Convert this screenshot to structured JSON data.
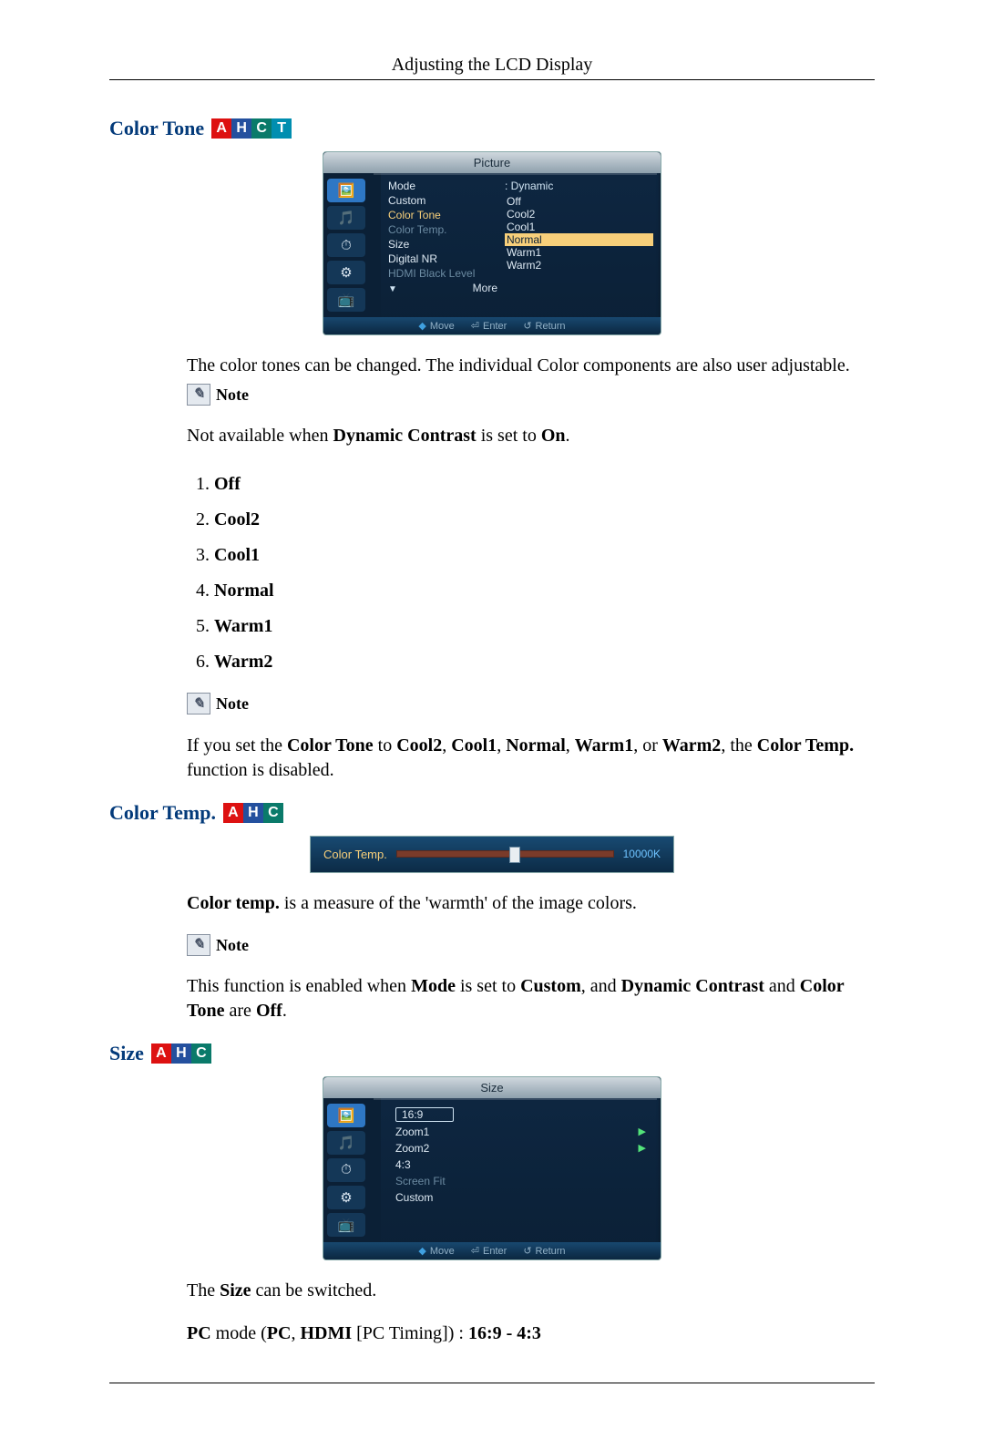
{
  "header": "Adjusting the LCD Display",
  "sections": {
    "colorTone": {
      "title": "Color Tone",
      "badges": [
        "A",
        "H",
        "C",
        "T"
      ],
      "osd": {
        "title": "Picture",
        "rows": [
          {
            "label": "Mode",
            "value": ": Dynamic"
          },
          {
            "label": "Custom",
            "value": ""
          },
          {
            "label": "Color Tone",
            "value": ": ",
            "sel": true
          },
          {
            "label": "Color Temp.",
            "value": ": ",
            "dim": true
          },
          {
            "label": "Size",
            "value": ": "
          },
          {
            "label": "Digital NR",
            "value": ": "
          },
          {
            "label": "HDMI Black Level",
            "value": ": ",
            "dim": true
          },
          {
            "label": "More",
            "value": "",
            "arrow": true
          }
        ],
        "options": [
          {
            "label": "Off"
          },
          {
            "label": "Cool2"
          },
          {
            "label": "Cool1"
          },
          {
            "label": "Normal",
            "hl": true
          },
          {
            "label": "Warm1"
          },
          {
            "label": "Warm2"
          }
        ],
        "footer": {
          "move": "Move",
          "enter": "Enter",
          "return": "Return"
        }
      },
      "desc": "The color tones can be changed. The individual Color components are also user adjustable.",
      "noteLabel": "Note",
      "noteText_parts": [
        "Not available when ",
        "Dynamic Contrast",
        " is set to ",
        "On",
        "."
      ],
      "list": [
        "Off",
        "Cool2",
        "Cool1",
        "Normal",
        "Warm1",
        "Warm2"
      ],
      "noteLabel2": "Note",
      "note2_parts": [
        "If you set the ",
        "Color Tone",
        " to ",
        "Cool2",
        ", ",
        "Cool1",
        ", ",
        "Normal",
        ", ",
        "Warm1",
        ", or ",
        "Warm2",
        ", the ",
        "Color Temp.",
        " function is disabled."
      ]
    },
    "colorTemp": {
      "title": "Color Temp.",
      "badges": [
        "A",
        "H",
        "C"
      ],
      "slider": {
        "label": "Color Temp.",
        "value": "10000K"
      },
      "desc_parts": [
        "Color temp.",
        " is a measure of the 'warmth' of the image colors."
      ],
      "noteLabel": "Note",
      "note_parts": [
        "This function is enabled when ",
        "Mode",
        " is set to ",
        "Custom",
        ", and ",
        "Dynamic Contrast",
        " and ",
        "Color Tone",
        " are ",
        "Off",
        "."
      ]
    },
    "size": {
      "title": "Size",
      "badges": [
        "A",
        "H",
        "C"
      ],
      "osd": {
        "title": "Size",
        "items": [
          {
            "label": "16:9",
            "boxed": true
          },
          {
            "label": "Zoom1",
            "tri": true
          },
          {
            "label": "Zoom2",
            "tri": true
          },
          {
            "label": "4:3"
          },
          {
            "label": "Screen Fit",
            "dim": true
          },
          {
            "label": "Custom"
          }
        ],
        "footer": {
          "move": "Move",
          "enter": "Enter",
          "return": "Return"
        }
      },
      "desc_parts": [
        "The ",
        "Size",
        " can be switched."
      ],
      "pcmode_parts": [
        "PC",
        " mode (",
        "PC",
        ", ",
        "HDMI",
        " [PC Timing]) : ",
        "16:9 - 4:3"
      ]
    }
  }
}
